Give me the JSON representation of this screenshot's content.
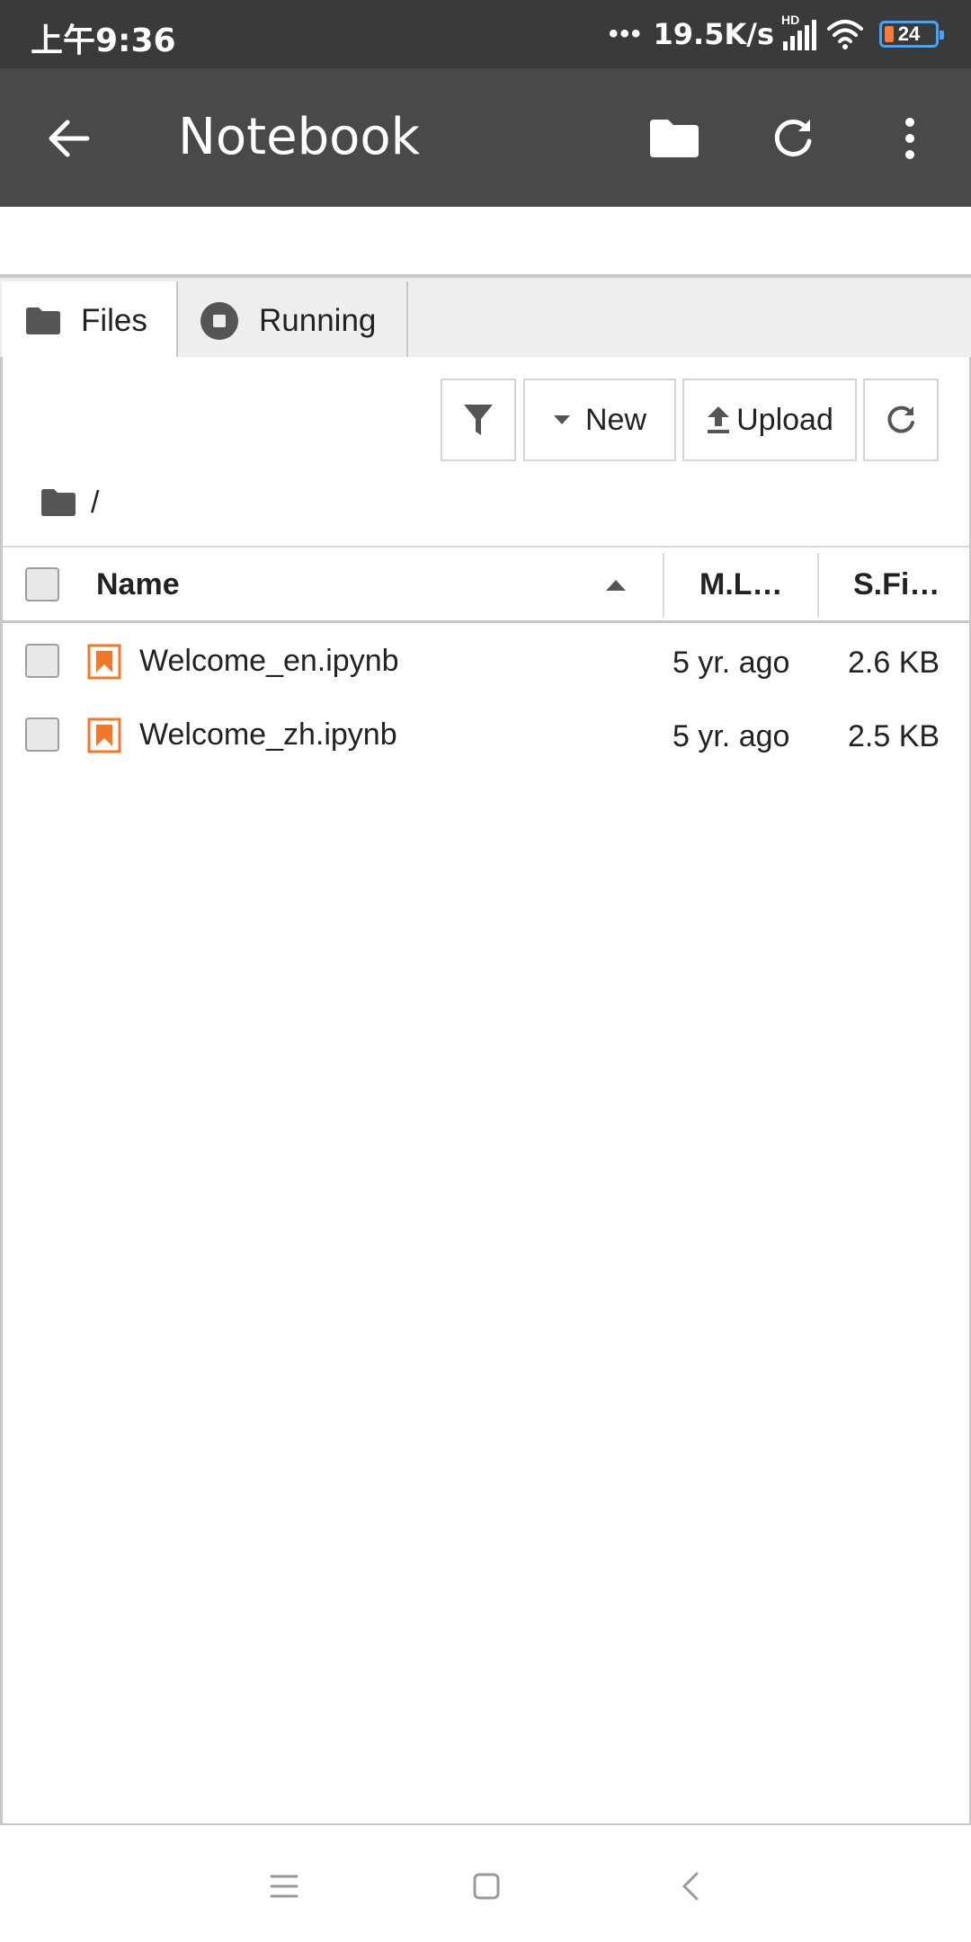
{
  "status_bar": {
    "time": "上午9:36",
    "dots": "•••",
    "network_speed": "19.5K/s",
    "hd_label": "HD",
    "battery_level": "24",
    "battery_color": "#3ea6ff"
  },
  "app_bar": {
    "title": "Notebook",
    "icons": [
      "arrow-left-icon",
      "folder-icon",
      "refresh-icon",
      "more-vertical-icon"
    ]
  },
  "tabs": [
    {
      "label": "Files",
      "icon": "folder-icon",
      "active": true
    },
    {
      "label": "Running",
      "icon": "stop-circle-icon",
      "active": false
    }
  ],
  "toolbar": {
    "new_label": "New",
    "upload_label": "Upload",
    "icons": [
      "filter-icon",
      "caret-down-icon",
      "upload-icon",
      "refresh-icon"
    ]
  },
  "breadcrumb": {
    "path": "/"
  },
  "file_list": {
    "columns": {
      "name": "Name",
      "modified": "M.L…",
      "size": "S.Fi…"
    },
    "sort_direction": "ascending",
    "rows": [
      {
        "name": "Welcome_en.ipynb",
        "modified": "5 yr. ago",
        "size": "2.6 KB"
      },
      {
        "name": "Welcome_zh.ipynb",
        "modified": "5 yr. ago",
        "size": "2.5 KB"
      }
    ]
  },
  "colors": {
    "app_bar": "#494949",
    "status_bar": "#3a3a3a",
    "notebook_icon": "#f37726"
  }
}
